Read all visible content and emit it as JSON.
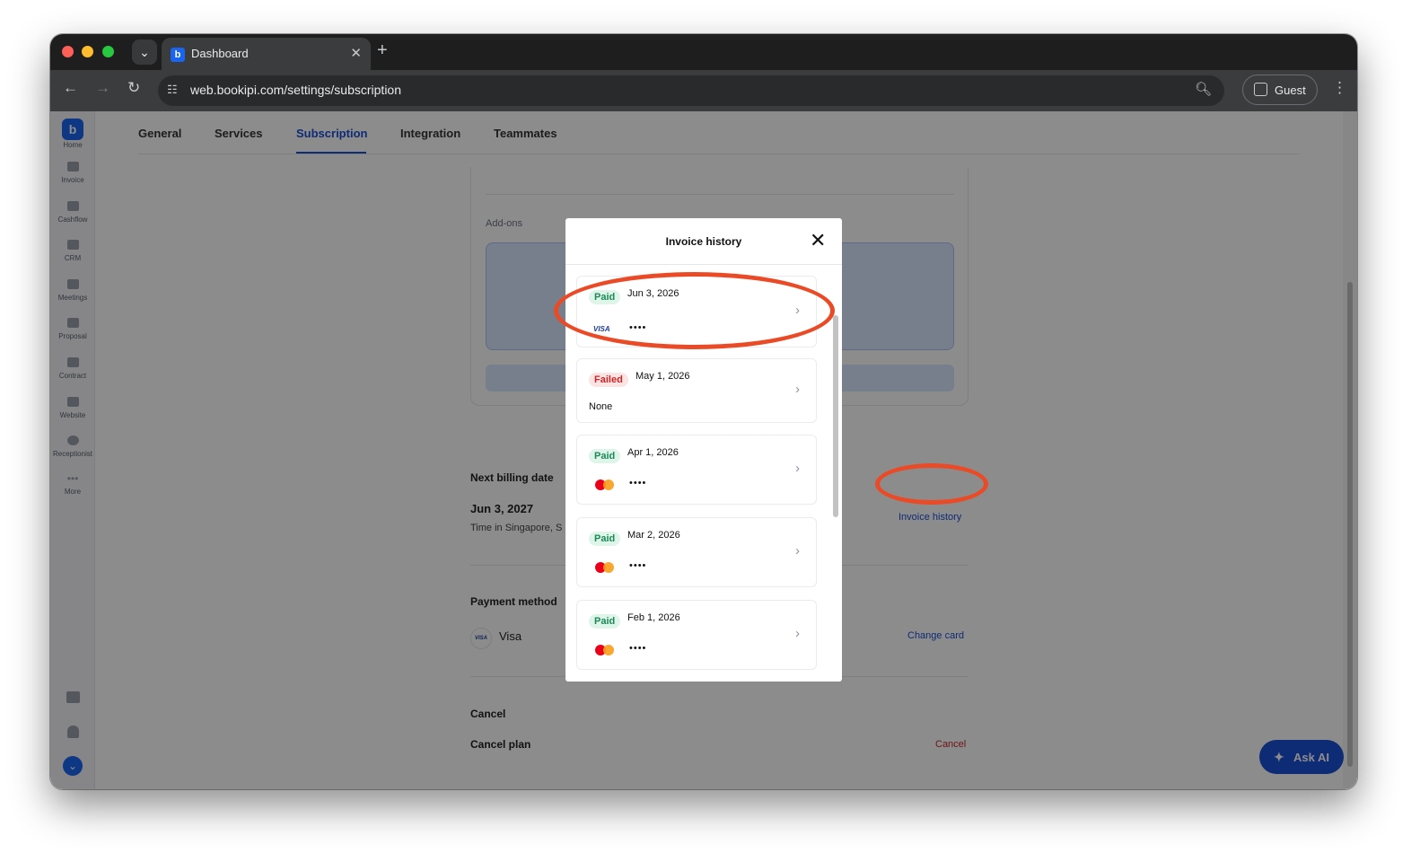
{
  "browser": {
    "tab_title": "Dashboard",
    "url": "web.bookipi.com/settings/subscription",
    "profile_label": "Guest"
  },
  "sidebar": {
    "items": [
      {
        "label": "Home"
      },
      {
        "label": "Invoice"
      },
      {
        "label": "Cashflow"
      },
      {
        "label": "CRM"
      },
      {
        "label": "Meetings"
      },
      {
        "label": "Proposal"
      },
      {
        "label": "Contract"
      },
      {
        "label": "Website"
      },
      {
        "label": "Receptionist"
      },
      {
        "label": "More"
      }
    ]
  },
  "settings_tabs": [
    "General",
    "Services",
    "Subscription",
    "Integration",
    "Teammates"
  ],
  "subscription": {
    "addons_label": "Add-ons",
    "next_billing_label": "Next billing date",
    "next_billing_date": "Jun 3, 2027",
    "timezone_note": "Time in Singapore, S",
    "invoice_history_link": "Invoice history",
    "payment_method_label": "Payment method",
    "payment_method_value": "Visa",
    "change_card_link": "Change card",
    "cancel_heading": "Cancel",
    "cancel_plan_label": "Cancel plan",
    "cancel_link": "Cancel"
  },
  "ask_ai_label": "Ask AI",
  "modal": {
    "title": "Invoice history",
    "invoices": [
      {
        "status": "Paid",
        "date": "Jun 3, 2026",
        "card": "visa",
        "masked": "••••"
      },
      {
        "status": "Failed",
        "date": "May 1, 2026",
        "card": "none",
        "masked": "None"
      },
      {
        "status": "Paid",
        "date": "Apr 1, 2026",
        "card": "mastercard",
        "masked": "••••"
      },
      {
        "status": "Paid",
        "date": "Mar 2, 2026",
        "card": "mastercard",
        "masked": "••••"
      },
      {
        "status": "Paid",
        "date": "Feb 1, 2026",
        "card": "mastercard",
        "masked": "••••"
      }
    ]
  },
  "colors": {
    "accent": "#1a4fd6",
    "annotation": "#ea4a26",
    "paid": "#1b8a56",
    "failed": "#c62828"
  }
}
